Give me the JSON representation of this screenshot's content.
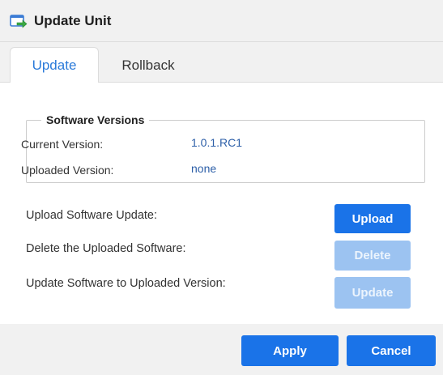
{
  "window": {
    "title": "Update Unit",
    "icon": "update-unit-icon"
  },
  "tabs": [
    {
      "label": "Update",
      "active": true
    },
    {
      "label": "Rollback",
      "active": false
    }
  ],
  "software_versions": {
    "legend": "Software Versions",
    "current_label": "Current Version:",
    "current_value": "1.0.1.RC1",
    "uploaded_label": "Uploaded Version:",
    "uploaded_value": "none"
  },
  "actions": {
    "upload_label": "Upload Software Update:",
    "upload_button": "Upload",
    "delete_label": "Delete the Uploaded Software:",
    "delete_button": "Delete",
    "update_label": "Update Software to Uploaded Version:",
    "update_button": "Update"
  },
  "footer": {
    "apply_button": "Apply",
    "cancel_button": "Cancel"
  },
  "colors": {
    "accent": "#1a73e8",
    "accent_disabled": "#9cc3f1",
    "link_value": "#2d5fa8",
    "active_tab": "#2a7ad9",
    "chrome_bg": "#f1f1f1"
  }
}
